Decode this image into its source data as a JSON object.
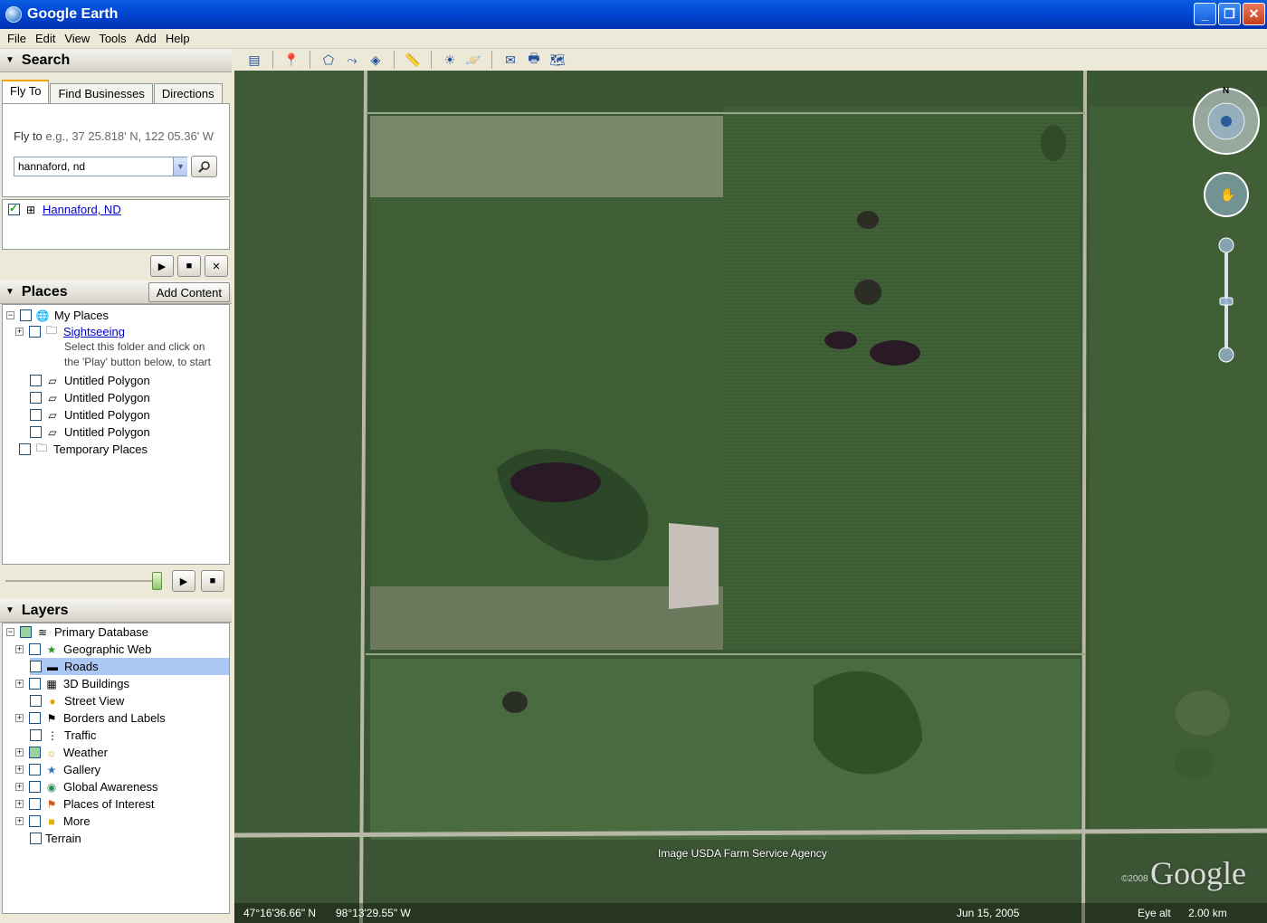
{
  "window": {
    "title": "Google Earth"
  },
  "menu": [
    "File",
    "Edit",
    "View",
    "Tools",
    "Add",
    "Help"
  ],
  "search": {
    "header": "Search",
    "tabs": [
      "Fly To",
      "Find Businesses",
      "Directions"
    ],
    "flyto_label": "Fly to",
    "flyto_hint": "e.g., 37 25.818' N, 122 05.36' W",
    "input_value": "hannaford, nd",
    "result": "Hannaford, ND"
  },
  "places": {
    "header": "Places",
    "add_content": "Add Content",
    "items": {
      "my_places": "My Places",
      "sightseeing": "Sightseeing",
      "desc1": "Select this folder and click on",
      "desc2": "the 'Play' button below, to start",
      "poly1": "Untitled Polygon",
      "poly2": "Untitled Polygon",
      "poly3": "Untitled Polygon",
      "poly4": "Untitled Polygon",
      "temp": "Temporary Places"
    }
  },
  "layers": {
    "header": "Layers",
    "items": {
      "primary": "Primary Database",
      "geoweb": "Geographic Web",
      "roads": "Roads",
      "buildings": "3D Buildings",
      "streetview": "Street View",
      "borders": "Borders and Labels",
      "traffic": "Traffic",
      "weather": "Weather",
      "gallery": "Gallery",
      "global": "Global Awareness",
      "poi": "Places of Interest",
      "more": "More",
      "terrain": "Terrain"
    }
  },
  "map": {
    "credit": "Image USDA Farm Service Agency",
    "brand": "Google",
    "copyright": "©2008",
    "lat": "47°16'36.66\" N",
    "lon": "98°13'29.55\" W",
    "date": "Jun 15, 2005",
    "eye_label": "Eye alt",
    "eye_value": "2.00 km",
    "north": "N"
  },
  "colors": {
    "title_blue": "#0348d6",
    "selection": "#abc8f4",
    "link": "#0000cc"
  }
}
